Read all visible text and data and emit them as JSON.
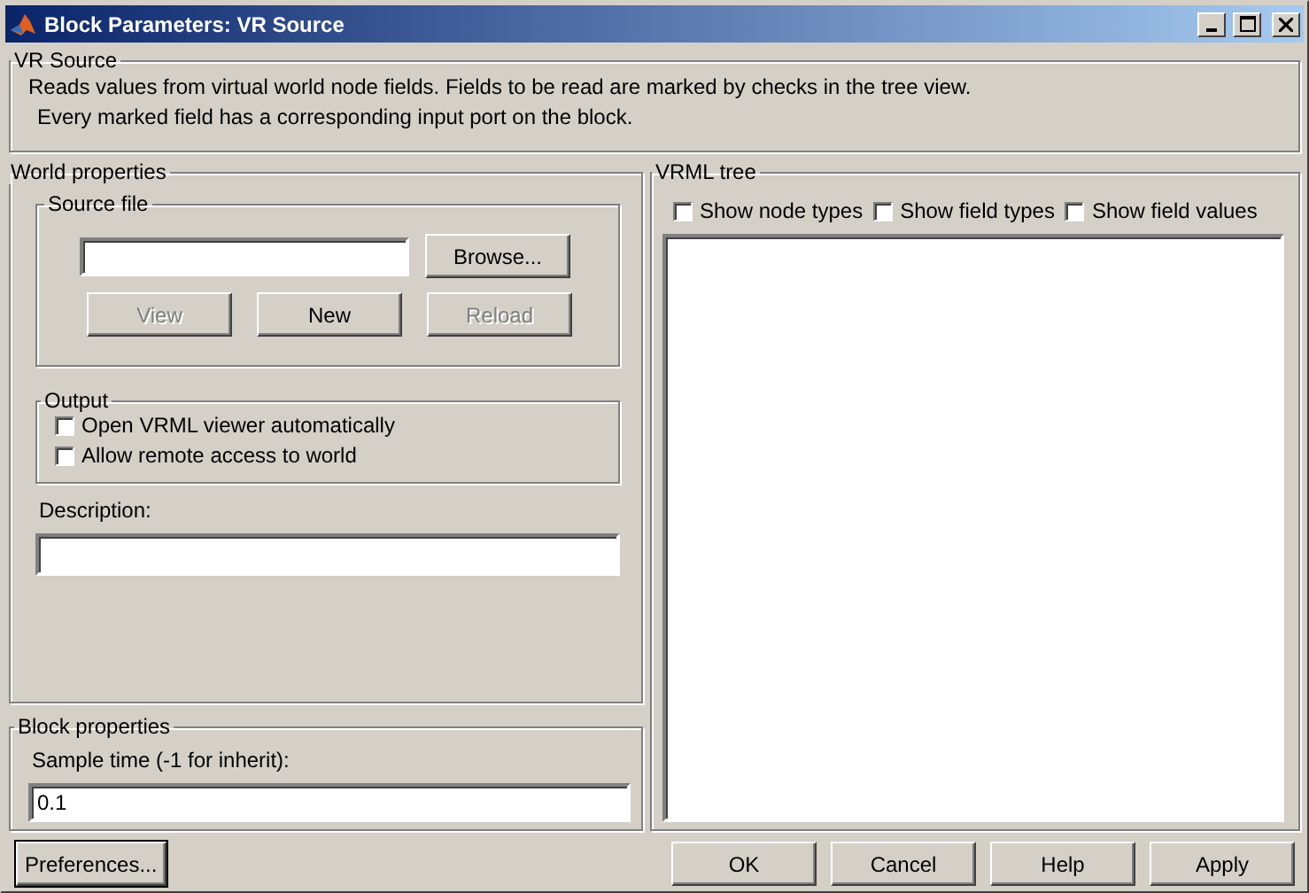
{
  "window": {
    "title": "Block Parameters: VR Source"
  },
  "description": {
    "title": "VR Source",
    "lines": [
      "Reads values from virtual world node fields. Fields to be read are marked by checks in the tree view.",
      "Every marked field has a corresponding input port on the block."
    ]
  },
  "world_properties": {
    "title": "World properties",
    "source_file": {
      "title": "Source file",
      "browse": {
        "label": "Browse...",
        "disabled": false
      },
      "buttons": [
        {
          "label": "View",
          "disabled": true
        },
        {
          "label": "New",
          "disabled": false
        },
        {
          "label": "Reload",
          "disabled": true
        }
      ]
    },
    "output": {
      "title": "Output",
      "options": [
        {
          "label": "Open VRML viewer automatically",
          "checked": false
        },
        {
          "label": "Allow remote access to world",
          "checked": false
        }
      ]
    },
    "description_label": "Description:"
  },
  "block_properties": {
    "title": "Block properties",
    "sample_time_label": "Sample time (-1 for inherit):",
    "sample_time": "0.1"
  },
  "vrml_tree": {
    "title": "VRML tree",
    "options": [
      {
        "label": "Show node types",
        "checked": false
      },
      {
        "label": "Show field types",
        "checked": false
      },
      {
        "label": "Show field values",
        "checked": false
      }
    ]
  },
  "footer": {
    "left": [
      {
        "label": "Preferences...",
        "focused": true
      }
    ],
    "right": [
      {
        "label": "OK",
        "focused": false
      },
      {
        "label": "Cancel",
        "focused": false
      },
      {
        "label": "Help",
        "focused": false
      },
      {
        "label": "Apply",
        "focused": false
      }
    ]
  }
}
